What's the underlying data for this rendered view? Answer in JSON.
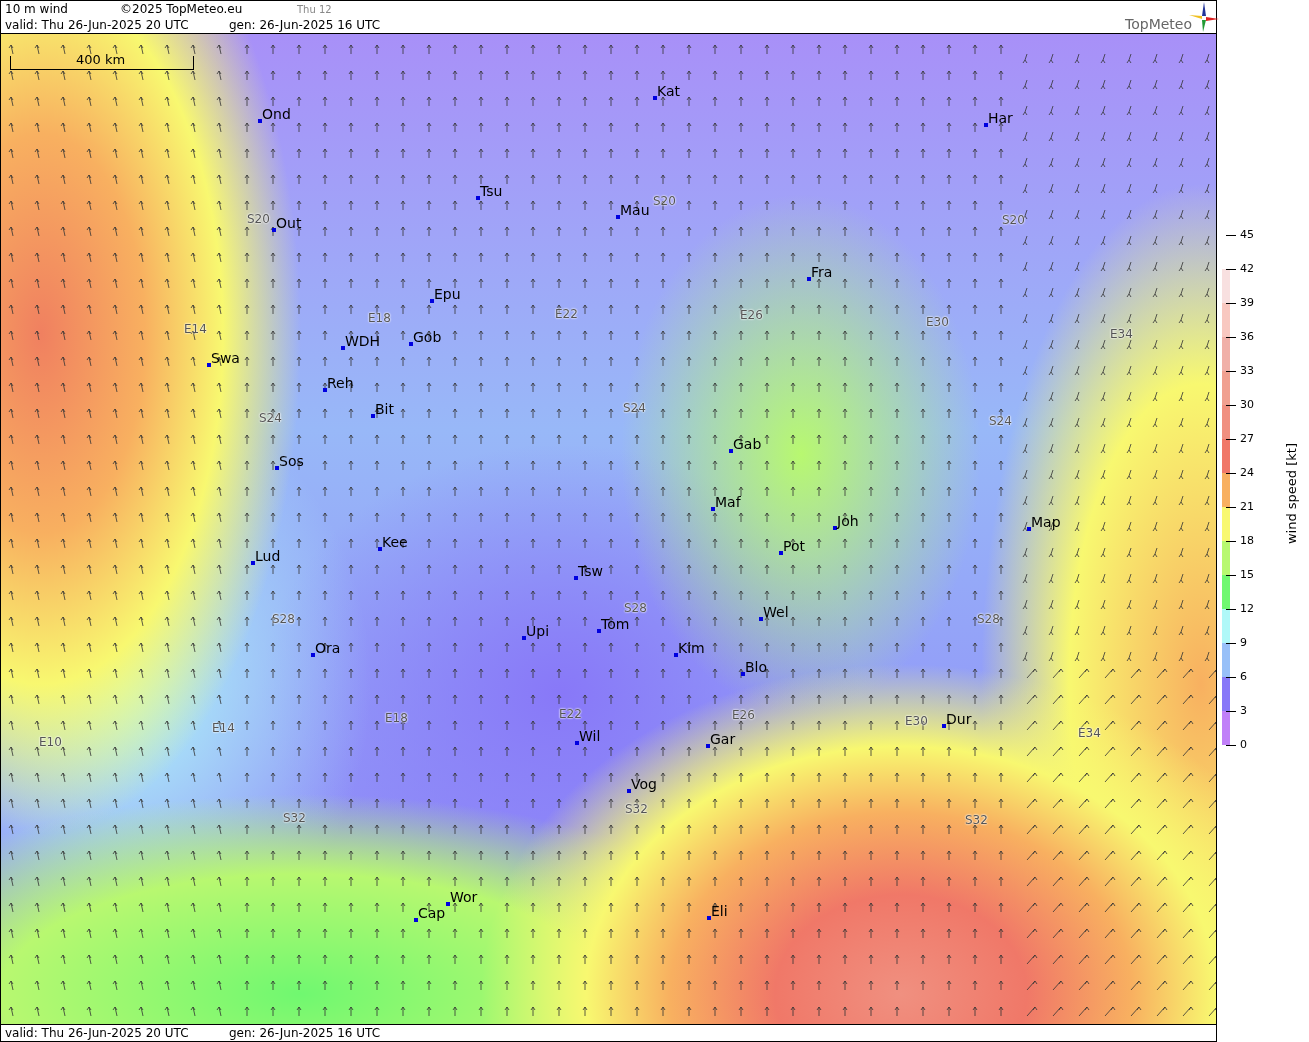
{
  "header": {
    "title": "10 m wind",
    "copyright": "©2025 TopMeteo.eu",
    "frame": "Thu 12",
    "valid": "valid:  Thu  26-Jun-2025  20 UTC",
    "generated": "gen: 26-Jun-2025 16 UTC",
    "logo": "TopMeteo"
  },
  "map": {
    "scale": "400 km",
    "cities": [
      "Ond",
      "Kat",
      "Har",
      "Tsu",
      "Mau",
      "Out",
      "Fra",
      "Epu",
      "WDH",
      "Gob",
      "Swa",
      "Reh",
      "Bit",
      "Gab",
      "Sos",
      "Maf",
      "Joh",
      "Map",
      "Pot",
      "Kee",
      "Lud",
      "Tsw",
      "Wel",
      "Upi",
      "Tom",
      "Kim",
      "Ora",
      "Blo",
      "Dur",
      "Wil",
      "Gar",
      "Vog",
      "Eli",
      "Wor",
      "Cap"
    ],
    "grid_labels": [
      "S20",
      "S20",
      "S20",
      "E14",
      "E18",
      "E22",
      "E26",
      "E30",
      "E34",
      "S24",
      "S24",
      "S24",
      "S28",
      "S28",
      "S28",
      "E10",
      "E14",
      "E18",
      "E22",
      "E26",
      "E30",
      "E34",
      "S32",
      "S32",
      "S32"
    ]
  },
  "legend": {
    "title": "wind speed [kt]",
    "ticks": [
      "45",
      "42",
      "39",
      "36",
      "33",
      "30",
      "27",
      "24",
      "21",
      "18",
      "15",
      "12",
      "9",
      "6",
      "3",
      "0"
    ],
    "bins": [
      {
        "color": "#c080f8"
      },
      {
        "color": "#8878f8"
      },
      {
        "color": "#98c0f8"
      },
      {
        "color": "#b0f8f8"
      },
      {
        "color": "#70f870"
      },
      {
        "color": "#b8f870"
      },
      {
        "color": "#f8f870"
      },
      {
        "color": "#f8b060"
      },
      {
        "color": "#f07868"
      },
      {
        "color": "#f09080"
      },
      {
        "color": "#f0a090"
      },
      {
        "color": "#f0b0a8"
      },
      {
        "color": "#f8c8c0"
      },
      {
        "color": "#f8e0e0"
      }
    ]
  },
  "footer": {
    "valid": "valid:  Thu  26-Jun-2025  20 UTC",
    "generated": "gen: 26-Jun-2025 16 UTC"
  }
}
